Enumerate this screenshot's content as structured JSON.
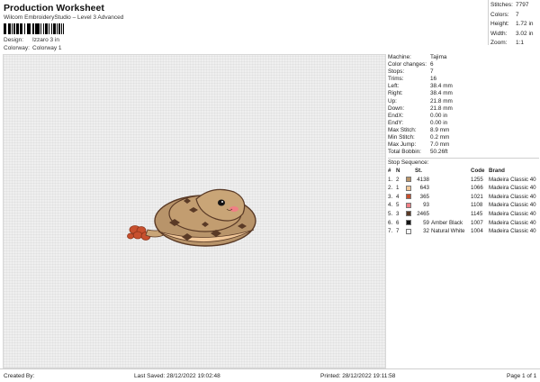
{
  "header": {
    "title": "Production Worksheet",
    "subtitle": "Wilcom EmbroideryStudio – Level 3 Advanced",
    "design_label": "Design:",
    "design_value": "Izzaro 3 in",
    "colorway_label": "Colorway:",
    "colorway_value": "Colorway 1"
  },
  "top_stats": [
    {
      "label": "Stitches:",
      "value": "7797"
    },
    {
      "label": "Colors:",
      "value": "7"
    },
    {
      "label": "Height:",
      "value": "1.72 in"
    },
    {
      "label": "Width:",
      "value": "3.02 in"
    },
    {
      "label": "Zoom:",
      "value": "1:1"
    }
  ],
  "machine_info": [
    {
      "label": "Machine:",
      "value": "Tajima"
    },
    {
      "label": "Color changes:",
      "value": "6"
    },
    {
      "label": "Stops:",
      "value": "7"
    },
    {
      "label": "Trims:",
      "value": "16"
    },
    {
      "label": "Left:",
      "value": "38.4 mm"
    },
    {
      "label": "Right:",
      "value": "38.4 mm"
    },
    {
      "label": "Up:",
      "value": "21.8 mm"
    },
    {
      "label": "Down:",
      "value": "21.8 mm"
    },
    {
      "label": "EndX:",
      "value": "0.00 in"
    },
    {
      "label": "EndY:",
      "value": "0.00 in"
    },
    {
      "label": "Max Stitch:",
      "value": "8.9 mm"
    },
    {
      "label": "Min Stitch:",
      "value": "0.2 mm"
    },
    {
      "label": "Max Jump:",
      "value": "7.0 mm"
    },
    {
      "label": "Total Bobbin:",
      "value": "50.26ft"
    }
  ],
  "stop_sequence": {
    "title": "Stop Sequence:",
    "headers": {
      "num": "#",
      "n": "N",
      "st": "St.",
      "code": "Code",
      "brand": "Brand"
    },
    "rows": [
      {
        "num": "1.",
        "n": "2",
        "swatch": "#b8946a",
        "st": "4138",
        "name": "",
        "code": "1255",
        "brand": "Madeira Classic 40"
      },
      {
        "num": "2.",
        "n": "1",
        "swatch": "#f3c99a",
        "st": "643",
        "name": "",
        "code": "1066",
        "brand": "Madeira Classic 40"
      },
      {
        "num": "3.",
        "n": "4",
        "swatch": "#c8502e",
        "st": "365",
        "name": "",
        "code": "1021",
        "brand": "Madeira Classic 40"
      },
      {
        "num": "4.",
        "n": "5",
        "swatch": "#f07f85",
        "st": "93",
        "name": "",
        "code": "1108",
        "brand": "Madeira Classic 40"
      },
      {
        "num": "5.",
        "n": "3",
        "swatch": "#5a3a26",
        "st": "2465",
        "name": "",
        "code": "1145",
        "brand": "Madeira Classic 40"
      },
      {
        "num": "6.",
        "n": "6",
        "swatch": "#141414",
        "st": "59",
        "name": "Amber Black",
        "code": "1007",
        "brand": "Madeira Classic 40"
      },
      {
        "num": "7.",
        "n": "7",
        "swatch": "#f4f4f4",
        "st": "32",
        "name": "Natural White",
        "code": "1004",
        "brand": "Madeira Classic 40"
      }
    ]
  },
  "footer": {
    "created_by": "Created By:",
    "last_saved": "Last Saved: 28/12/2022 19:02:48",
    "printed": "Printed: 28/12/2022 19:11:58",
    "page": "Page 1 of 1"
  }
}
